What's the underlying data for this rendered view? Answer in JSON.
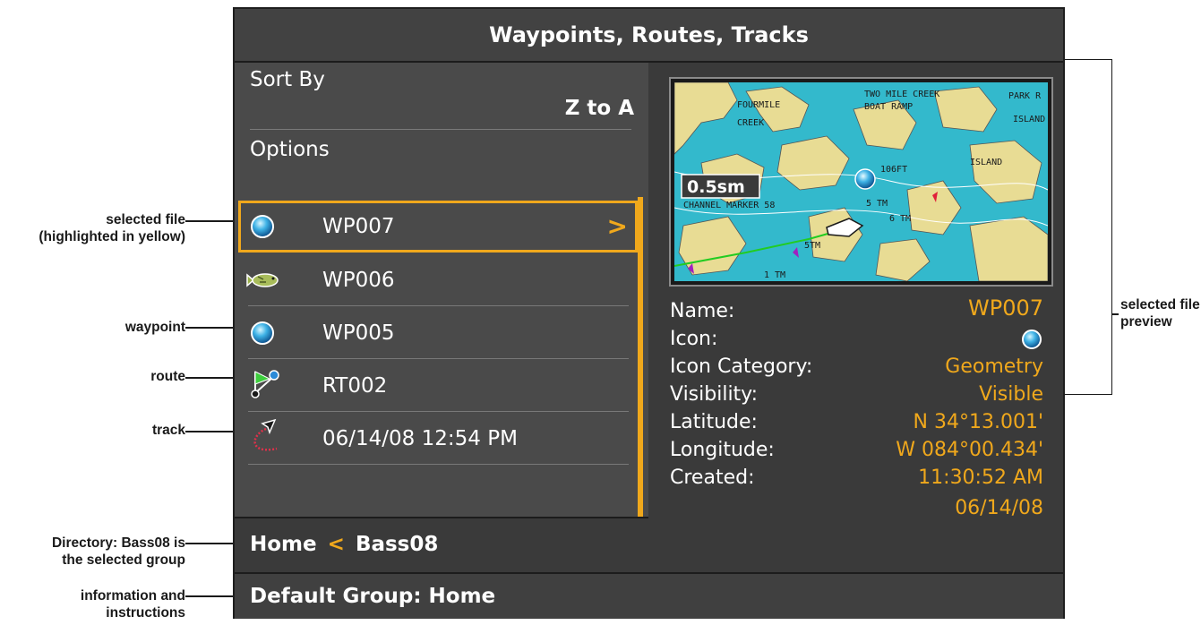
{
  "window": {
    "title": "Waypoints, Routes, Tracks"
  },
  "sort": {
    "label": "Sort By",
    "value": "Z to A"
  },
  "options": {
    "label": "Options"
  },
  "list": {
    "items": [
      {
        "label": "WP007",
        "icon": "waypoint-sphere-icon",
        "selected": true
      },
      {
        "label": "WP006",
        "icon": "fish-icon",
        "selected": false
      },
      {
        "label": "WP005",
        "icon": "waypoint-sphere-icon",
        "selected": false
      },
      {
        "label": "RT002",
        "icon": "route-icon",
        "selected": false
      },
      {
        "label": "06/14/08 12:54 PM",
        "icon": "track-icon",
        "selected": false
      }
    ]
  },
  "preview": {
    "map": {
      "scale": "0.5sm",
      "labels": [
        "FOURMILE",
        "CREEK",
        "TWO MILE CREEK",
        "BOAT RAMP",
        "PARK R",
        "ISLAND",
        "ISLAND",
        "106FT",
        "CHANNEL MARKER 58",
        "5 TM",
        "6 TM",
        "5TM",
        "1 TM"
      ]
    },
    "fields": [
      {
        "label": "Name:",
        "value": "WP007"
      },
      {
        "label": "Icon:",
        "value": ""
      },
      {
        "label": "Icon Category:",
        "value": "Geometry"
      },
      {
        "label": "Visibility:",
        "value": "Visible"
      },
      {
        "label": "Latitude:",
        "value": "N 34°13.001'"
      },
      {
        "label": "Longitude:",
        "value": "W 084°00.434'"
      },
      {
        "label": "Created:",
        "value": "11:30:52 AM"
      }
    ],
    "created_date": "06/14/08"
  },
  "directory": {
    "root": "Home",
    "separator": "<",
    "current": "Bass08"
  },
  "infobar": {
    "text": "Default Group: Home"
  },
  "annotations": {
    "selected_file": "selected file",
    "selected_file_sub": "(highlighted in yellow)",
    "waypoint": "waypoint",
    "route": "route",
    "track": "track",
    "directory": "Directory: Bass08 is",
    "directory_sub": "the selected group",
    "info": "information and",
    "info_sub": "instructions",
    "preview": "selected file",
    "preview_sub": "preview"
  },
  "colors": {
    "accent": "#f0a81c",
    "panel": "#4a4a4a",
    "background": "#3a3a3a",
    "text": "#ffffff"
  }
}
